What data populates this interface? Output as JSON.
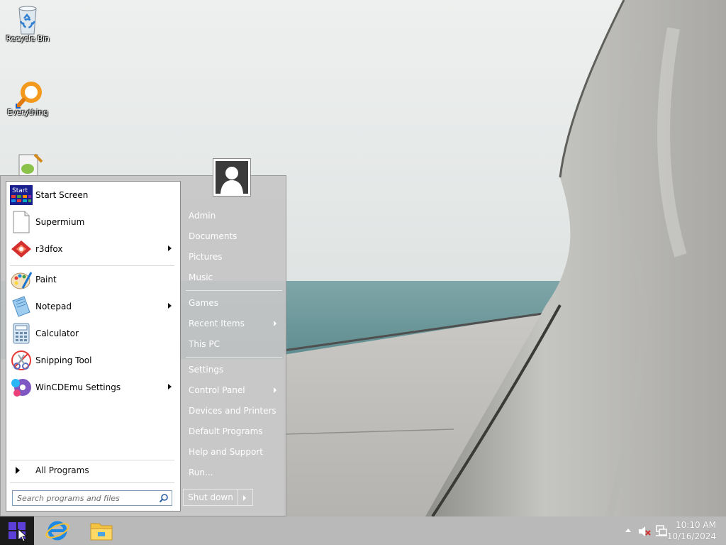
{
  "desktop": {
    "icons": [
      {
        "label": "Recycle Bin",
        "icon": "recycle-bin-icon"
      },
      {
        "label": "Everything",
        "icon": "everything-search-icon"
      },
      {
        "label": "",
        "icon": "notepad-plus-plus-icon"
      }
    ]
  },
  "start_menu": {
    "pinned": [
      {
        "label": "Start Screen",
        "icon": "start-screen-icon",
        "submenu": false
      },
      {
        "label": "Supermium",
        "icon": "blank-document-icon",
        "submenu": false
      },
      {
        "label": "r3dfox",
        "icon": "r3dfox-icon",
        "submenu": true
      }
    ],
    "recent": [
      {
        "label": "Paint",
        "icon": "paint-icon",
        "submenu": false
      },
      {
        "label": "Notepad",
        "icon": "notepad-icon",
        "submenu": true
      },
      {
        "label": "Calculator",
        "icon": "calculator-icon",
        "submenu": false
      },
      {
        "label": "Snipping Tool",
        "icon": "snipping-tool-icon",
        "submenu": false
      },
      {
        "label": "WinCDEmu Settings",
        "icon": "wincdemu-icon",
        "submenu": true
      }
    ],
    "all_programs": "All Programs",
    "search_placeholder": "Search programs and files",
    "right_links": {
      "group1": [
        {
          "label": "Admin",
          "submenu": false
        },
        {
          "label": "Documents",
          "submenu": false
        },
        {
          "label": "Pictures",
          "submenu": false
        },
        {
          "label": "Music",
          "submenu": false
        }
      ],
      "group2": [
        {
          "label": "Games",
          "submenu": false
        },
        {
          "label": "Recent Items",
          "submenu": true
        },
        {
          "label": "This PC",
          "submenu": false
        }
      ],
      "group3": [
        {
          "label": "Settings",
          "submenu": false
        },
        {
          "label": "Control Panel",
          "submenu": true
        },
        {
          "label": "Devices and Printers",
          "submenu": false
        },
        {
          "label": "Default Programs",
          "submenu": false
        },
        {
          "label": "Help and Support",
          "submenu": false
        },
        {
          "label": "Run...",
          "submenu": false
        }
      ]
    },
    "shutdown_label": "Shut down"
  },
  "taskbar": {
    "apps": [
      {
        "name": "internet-explorer-icon"
      },
      {
        "name": "file-explorer-icon"
      }
    ],
    "clock": {
      "time": "10:10 AM",
      "date": "10/16/2024"
    }
  },
  "colors": {
    "taskbar": "#b9b9b9",
    "start_menu_bg": "#c6c6c6",
    "start_button": "#1b1b1b",
    "windows_logo": "#5b3fd6"
  }
}
